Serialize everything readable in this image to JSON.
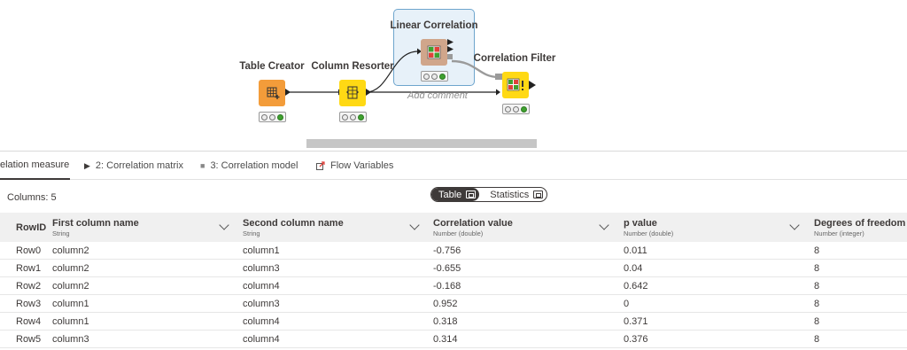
{
  "workflow": {
    "nodes": [
      {
        "title": "Table Creator",
        "status": [
          "off",
          "off",
          "green"
        ],
        "color": "#f39c3a",
        "icon": "table-creator-icon"
      },
      {
        "title": "Column Resorter",
        "status": [
          "off",
          "off",
          "green"
        ],
        "color": "#ffd914",
        "icon": "column-resorter-icon"
      },
      {
        "title": "Linear Correlation",
        "status": [
          "off",
          "off",
          "green"
        ],
        "color": "#d0a68b",
        "icon": "linear-correlation-icon"
      },
      {
        "title": "Correlation Filter",
        "status": [
          "off",
          "off",
          "green"
        ],
        "color": "#ffd914",
        "icon": "correlation-filter-icon"
      }
    ],
    "annotation": "Add comment"
  },
  "tabs": [
    {
      "label": "elation measure",
      "icon": "",
      "active": true
    },
    {
      "label": "2: Correlation matrix",
      "icon": "play-icon",
      "active": false
    },
    {
      "label": "3: Correlation model",
      "icon": "square-icon",
      "active": false
    },
    {
      "label": "Flow Variables",
      "icon": "flow-variables-icon",
      "active": false
    }
  ],
  "table_view": {
    "columns_label": "Columns: 5",
    "toggle": {
      "table": "Table",
      "statistics": "Statistics",
      "selected": "Table"
    }
  },
  "table": {
    "rowid_header": "RowID",
    "columns": [
      {
        "name": "First column name",
        "type": "String"
      },
      {
        "name": "Second column name",
        "type": "String"
      },
      {
        "name": "Correlation value",
        "type": "Number (double)"
      },
      {
        "name": "p value",
        "type": "Number (double)"
      },
      {
        "name": "Degrees of freedom",
        "type": "Number (integer)"
      }
    ],
    "rows": [
      {
        "id": "Row0",
        "cells": [
          "column2",
          "column1",
          "-0.756",
          "0.011",
          "8"
        ]
      },
      {
        "id": "Row1",
        "cells": [
          "column2",
          "column3",
          "-0.655",
          "0.04",
          "8"
        ]
      },
      {
        "id": "Row2",
        "cells": [
          "column2",
          "column4",
          "-0.168",
          "0.642",
          "8"
        ]
      },
      {
        "id": "Row3",
        "cells": [
          "column1",
          "column3",
          "0.952",
          "0",
          "8"
        ]
      },
      {
        "id": "Row4",
        "cells": [
          "column1",
          "column4",
          "0.318",
          "0.371",
          "8"
        ]
      },
      {
        "id": "Row5",
        "cells": [
          "column3",
          "column4",
          "0.314",
          "0.376",
          "8"
        ]
      }
    ]
  }
}
